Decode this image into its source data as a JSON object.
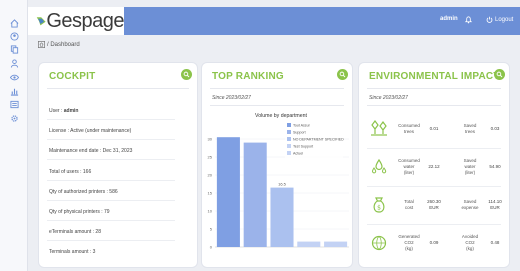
{
  "brand": {
    "name": "Gespage"
  },
  "header": {
    "user": "admin",
    "logout": "Logout"
  },
  "breadcrumb": {
    "label": "/ Dashboard"
  },
  "colors": {
    "topbar": "#6c8fd6",
    "accent": "#8bc34a",
    "bar": "#7f9fe3"
  },
  "sidebar": {
    "icons": [
      "home-icon",
      "user-circle-icon",
      "copy-icon",
      "person-icon",
      "eye-icon",
      "chart-icon",
      "list-icon",
      "gear-icon"
    ]
  },
  "cockpit": {
    "title": "COCKPIT",
    "stats": [
      {
        "text": "User : ",
        "strong": "admin"
      },
      {
        "text": "License : Active (under maintenance)"
      },
      {
        "text": "Maintenance end date : Dec 31, 2023"
      },
      {
        "text": "Total of users : 166"
      },
      {
        "text": "Qty of authorized printers : 586"
      },
      {
        "text": "Qty of physical printers : 79"
      },
      {
        "text": "eTerminals amount : 28"
      },
      {
        "text": "Terminals amount : 3"
      }
    ]
  },
  "ranking": {
    "title": "TOP RANKING",
    "since": "Since 2023/02/27"
  },
  "chart_data": {
    "type": "bar",
    "title": "Volume by department",
    "categories": [
      "Tout ASSUR",
      "Support",
      "NO DEPARTMENT SPECIFIED",
      "Test Support",
      "Actuel"
    ],
    "values": [
      30.5,
      29,
      16.5,
      1.5,
      1.5
    ],
    "data_labels": [
      "",
      "",
      "16.5",
      "",
      ""
    ],
    "ylim": [
      0,
      35
    ],
    "yticks": [
      0,
      5,
      10,
      15,
      20,
      25,
      30
    ],
    "legend": [
      "Tout Assur",
      "Support",
      "NO DEPARTMENT SPECIFIED",
      "Test Support",
      "Actuel"
    ],
    "legend_position": "top-right",
    "color": "#7f9fe3"
  },
  "environment": {
    "title": "ENVIRONMENTAL IMPACT",
    "since": "Since 2023/02/27",
    "rows": [
      {
        "icon": "trees-icon",
        "left_label": [
          "Consumed",
          "trees"
        ],
        "left_value": "0.01",
        "right_label": [
          "Saved",
          "trees"
        ],
        "right_value": "0.03"
      },
      {
        "icon": "water-drops-icon",
        "left_label": [
          "Consumed",
          "water",
          "(liter)"
        ],
        "left_value": "22.12",
        "right_label": [
          "Saved",
          "water",
          "(liter)"
        ],
        "right_value": "54.90"
      },
      {
        "icon": "money-bag-icon",
        "left_label": [
          "Total",
          "cost"
        ],
        "left_value": [
          "260.30",
          "EUR"
        ],
        "right_label": [
          "Saved",
          "expense"
        ],
        "right_value": [
          "114.10",
          "EUR"
        ]
      },
      {
        "icon": "globe-co2-icon",
        "left_label": [
          "Generated",
          "CO2",
          "(kg)"
        ],
        "left_value": "0.09",
        "right_label": [
          "Avoided",
          "CO2",
          "(kg)"
        ],
        "right_value": "0.48"
      }
    ]
  }
}
